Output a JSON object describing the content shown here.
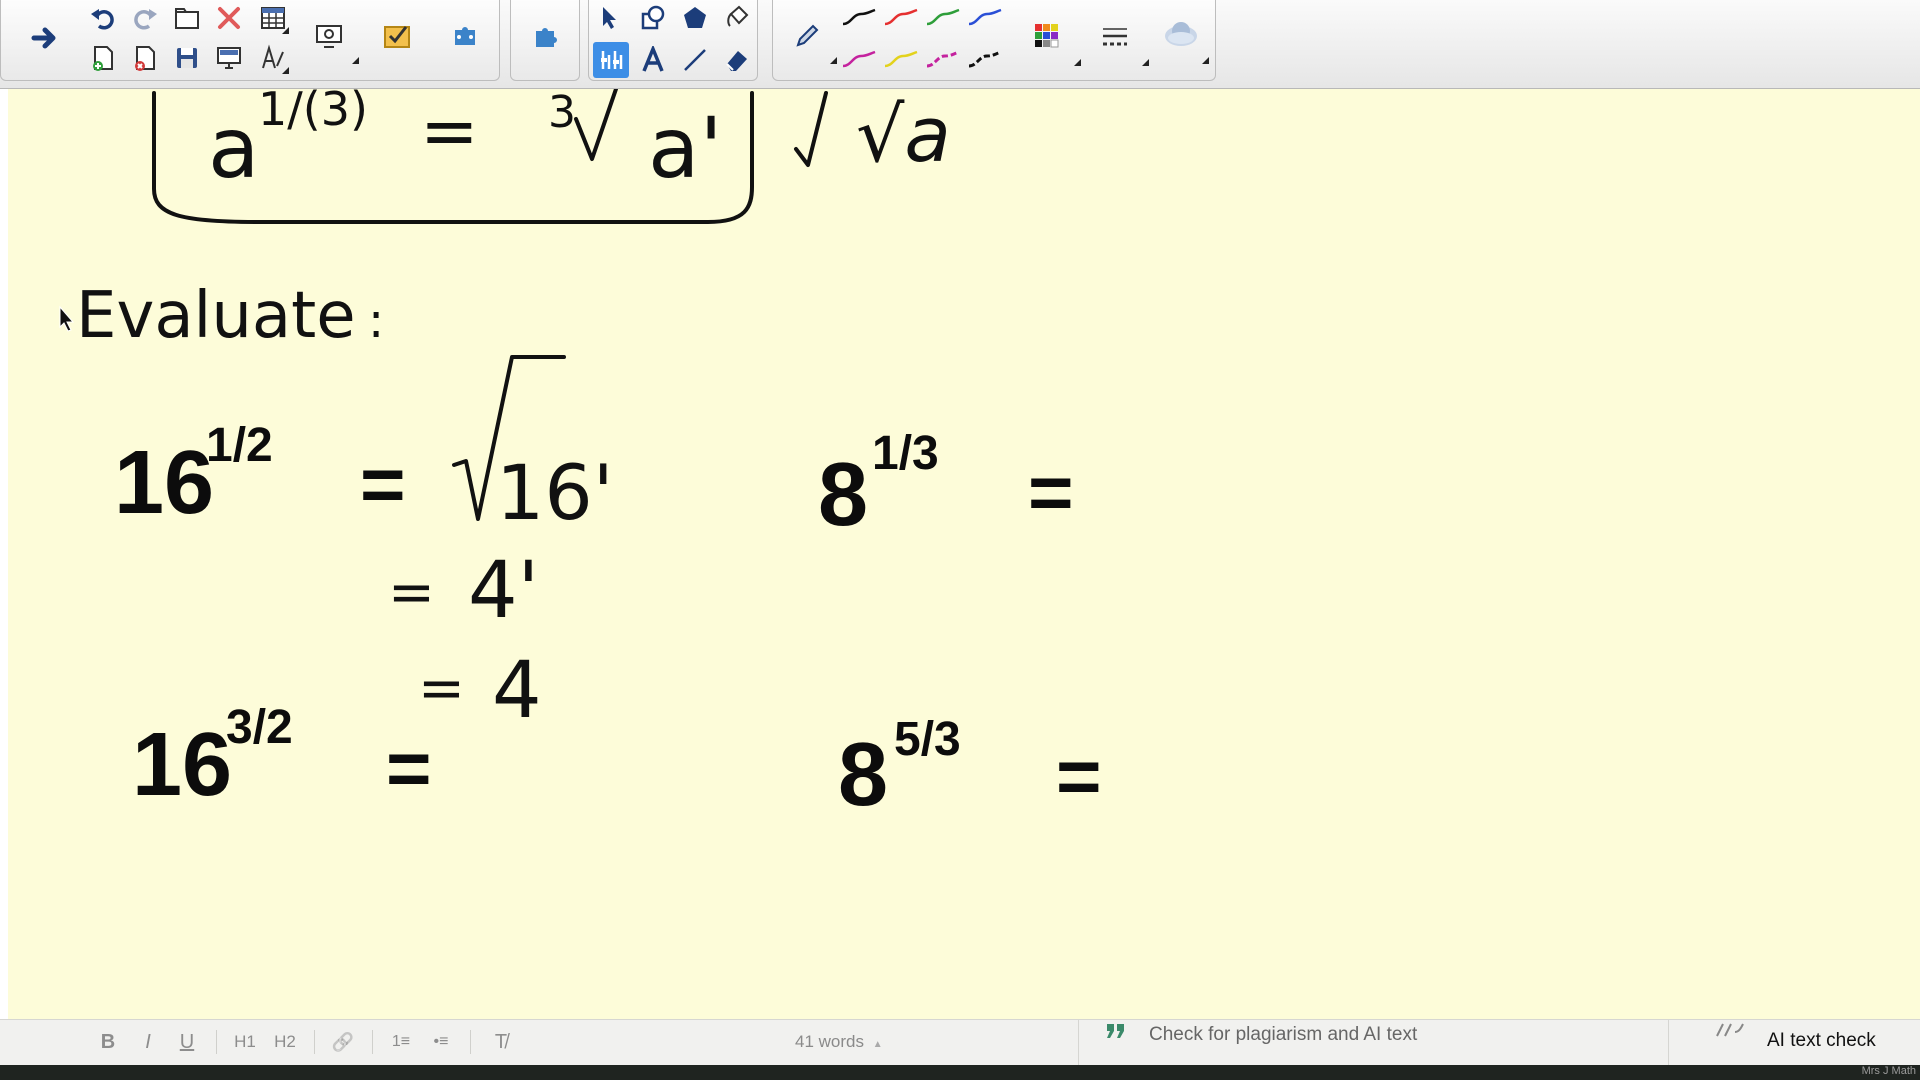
{
  "toolbar": {
    "buttons": [
      "next-page",
      "undo",
      "redo",
      "open-file",
      "delete",
      "table",
      "new-page",
      "new-page-from-template",
      "save",
      "screen-shade",
      "text-recognition",
      "screen-capture",
      "whiteboard-activity",
      "addons",
      "extension",
      "select",
      "shapes",
      "fill-shape",
      "paint-bucket",
      "recognition-tool",
      "text",
      "line",
      "eraser",
      "pen",
      "pen-black",
      "pen-red",
      "pen-green",
      "pen-blue",
      "pen-magenta",
      "pen-yellow",
      "pen-magenta-dashed",
      "pen-black-dashed",
      "color-palette",
      "line-style",
      "cloud-3d"
    ],
    "colors": {
      "accent": "#3d8ee6",
      "black": "#111111",
      "red": "#e53030",
      "green": "#2e9e3a",
      "blue": "#2a4fd6",
      "magenta": "#c4229e",
      "yellow": "#e3d21c"
    }
  },
  "canvas": {
    "background": "#fdfcd9",
    "box_formula": {
      "base": "a",
      "exponent": "1/(3)",
      "equals": "=",
      "root_index": "3",
      "radicand": "a'"
    },
    "side_formula": "√a",
    "prompt_label": "Evaluate",
    "prompt_colon": ":",
    "problems": [
      {
        "base": "16",
        "exponent": "1/2",
        "equals": "="
      },
      {
        "base": "8",
        "exponent": "1/3",
        "equals": "="
      },
      {
        "base": "16",
        "exponent": "3/2",
        "equals": "="
      },
      {
        "base": "8",
        "exponent": "5/3",
        "equals": "="
      }
    ],
    "work": [
      {
        "equals": "=",
        "root": "√",
        "radicand": "16'"
      },
      {
        "equals": "=",
        "value": "4'"
      },
      {
        "equals": "=",
        "value": "4"
      }
    ]
  },
  "editor_bar": {
    "format_buttons": [
      "B",
      "I",
      "U",
      "H1",
      "H2",
      "🔗",
      "1≡",
      "•≡",
      "T̸"
    ],
    "word_count": "41 words",
    "word_count_arrow": "▲",
    "plagiarism_label": "Check for plagiarism and AI text",
    "ai_label": "AI text check"
  },
  "footer": {
    "label": "Mrs J Math"
  }
}
